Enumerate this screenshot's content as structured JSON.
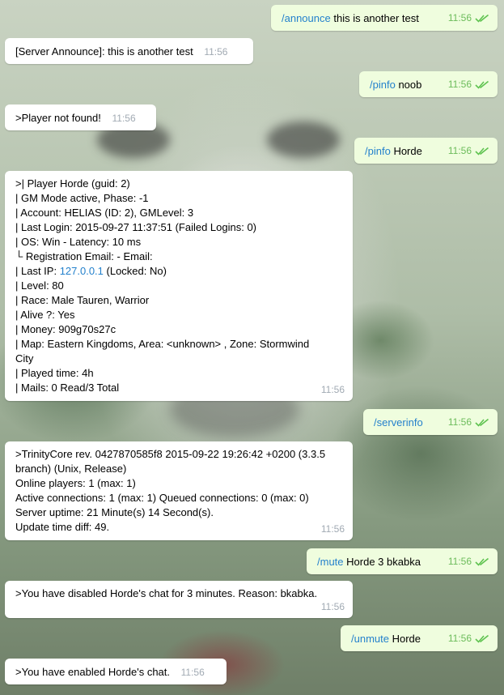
{
  "messages": [
    {
      "dir": "out",
      "cmd": "/announce",
      "text": "this is another test",
      "time": "11:56"
    },
    {
      "dir": "in",
      "text": "[Server Announce]: this is another test",
      "time": "11:56"
    },
    {
      "dir": "out",
      "cmd": "/pinfo",
      "text": "noob",
      "time": "11:56"
    },
    {
      "dir": "in",
      "text": ">Player not found!",
      "time": "11:56"
    },
    {
      "dir": "out",
      "cmd": "/pinfo",
      "text": "Horde",
      "time": "11:56"
    },
    {
      "dir": "in",
      "time": "11:56",
      "lines": [
        ">| Player Horde (guid: 2)",
        "| GM Mode active, Phase: -1",
        "| Account: HELIAS (ID: 2), GMLevel: 3",
        "| Last Login: 2015-09-27 11:37:51 (Failed Logins: 0)",
        "| OS: Win - Latency: 10 ms",
        "└ Registration Email: - Email:",
        "| Last IP: ",
        "127.0.0.1",
        " (Locked: No)",
        "| Level: 80",
        "| Race: Male Tauren, Warrior",
        "| Alive ?: Yes",
        "| Money: 909g70s27c",
        "| Map: Eastern Kingdoms, Area: <unknown> , Zone: Stormwind",
        "City",
        "| Played time: 4h",
        "| Mails: 0 Read/3 Total"
      ]
    },
    {
      "dir": "out",
      "cmd": "/serverinfo",
      "text": "",
      "time": "11:56"
    },
    {
      "dir": "in",
      "time": "11:56",
      "lines": [
        ">TrinityCore rev. 0427870585f8 2015-09-22 19:26:42 +0200 (3.3.5",
        "branch) (Unix, Release)",
        "Online players: 1 (max: 1)",
        "Active connections: 1 (max: 1) Queued connections: 0 (max: 0)",
        "Server uptime: 21 Minute(s) 14 Second(s).",
        "Update time diff: 49."
      ]
    },
    {
      "dir": "out",
      "cmd": "/mute",
      "text": "Horde 3 bkabka",
      "time": "11:56"
    },
    {
      "dir": "in",
      "text": ">You have disabled Horde's chat for 3 minutes. Reason: bkabka.",
      "time": "11:56"
    },
    {
      "dir": "out",
      "cmd": "/unmute",
      "text": "Horde",
      "time": "11:56"
    },
    {
      "dir": "in",
      "text": ">You have enabled Horde's chat.",
      "time": "11:56"
    }
  ],
  "icons": {
    "read": "double-check-icon"
  },
  "colors": {
    "outgoing_bg": "#effdde",
    "incoming_bg": "#ffffff",
    "link": "#2481cc",
    "time_out": "#6cbc5b",
    "time_in": "#a1aab3"
  }
}
